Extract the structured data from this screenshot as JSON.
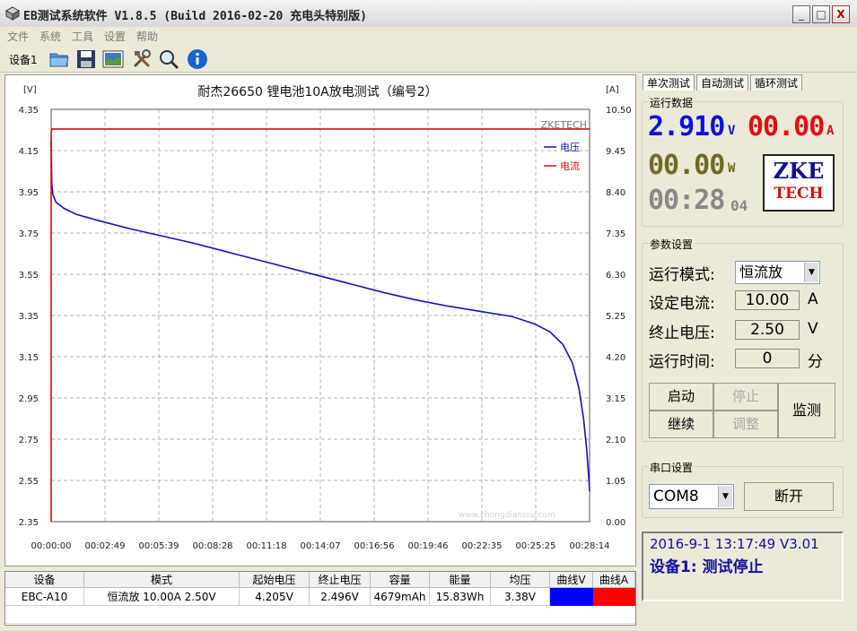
{
  "window": {
    "title": "EB测试系统软件 V1.8.5 (Build 2016-02-20 充电头特别版)",
    "buttons": [
      "_",
      "□",
      "X"
    ]
  },
  "menu": [
    "文件",
    "系统",
    "工具",
    "设置",
    "帮助"
  ],
  "toolbar": {
    "device_label": "设备1",
    "icons": [
      "open-folder-icon",
      "save-icon",
      "chart-image-icon",
      "tools-icon",
      "search-icon",
      "info-icon"
    ]
  },
  "chart_data": {
    "type": "line",
    "title": "耐杰26650 锂电池10A放电测试（编号2）",
    "left_axis_unit": "[V]",
    "right_axis_unit": "[A]",
    "watermark": "ZKETECH",
    "y_ticks": [
      "4.35",
      "4.15",
      "3.95",
      "3.75",
      "3.55",
      "3.35",
      "3.15",
      "2.95",
      "2.75",
      "2.55",
      "2.35"
    ],
    "y2_ticks": [
      "10.50",
      "9.45",
      "8.40",
      "7.35",
      "6.30",
      "5.25",
      "4.20",
      "3.15",
      "2.10",
      "1.05",
      "0.00"
    ],
    "x_ticks": [
      "00:00:00",
      "00:02:49",
      "00:05:39",
      "00:08:28",
      "00:11:18",
      "00:14:07",
      "00:16:56",
      "00:19:46",
      "00:22:35",
      "00:25:25",
      "00:28:14"
    ],
    "ylim": [
      2.35,
      4.35
    ],
    "y2lim": [
      0,
      10.5
    ],
    "xlim_seconds": [
      0,
      1694
    ],
    "grid": true,
    "legend_placement": "top-right",
    "series": [
      {
        "name": "电压",
        "color": "#1414b4",
        "axis": "left",
        "points": [
          [
            0,
            4.205
          ],
          [
            2,
            3.99
          ],
          [
            5,
            3.94
          ],
          [
            15,
            3.9
          ],
          [
            40,
            3.87
          ],
          [
            80,
            3.84
          ],
          [
            150,
            3.81
          ],
          [
            250,
            3.77
          ],
          [
            350,
            3.735
          ],
          [
            450,
            3.7
          ],
          [
            550,
            3.66
          ],
          [
            650,
            3.62
          ],
          [
            750,
            3.58
          ],
          [
            850,
            3.54
          ],
          [
            950,
            3.5
          ],
          [
            1050,
            3.46
          ],
          [
            1150,
            3.425
          ],
          [
            1250,
            3.395
          ],
          [
            1350,
            3.37
          ],
          [
            1450,
            3.345
          ],
          [
            1520,
            3.31
          ],
          [
            1570,
            3.27
          ],
          [
            1610,
            3.21
          ],
          [
            1640,
            3.12
          ],
          [
            1660,
            3.0
          ],
          [
            1675,
            2.85
          ],
          [
            1685,
            2.7
          ],
          [
            1692,
            2.55
          ],
          [
            1694,
            2.496
          ]
        ]
      },
      {
        "name": "电流",
        "color": "#d41010",
        "axis": "right",
        "points": [
          [
            0,
            0
          ],
          [
            0,
            9.9
          ],
          [
            2,
            10.0
          ],
          [
            1694,
            10.0
          ]
        ]
      }
    ]
  },
  "table": {
    "headers": [
      "设备",
      "模式",
      "起始电压",
      "终止电压",
      "容量",
      "能量",
      "均压",
      "曲线V",
      "曲线A"
    ],
    "rows": [
      {
        "device": "EBC-A10",
        "mode": "恒流放 10.00A 2.50V",
        "start_v": "4.205V",
        "end_v": "2.496V",
        "capacity": "4679mAh",
        "energy": "15.83Wh",
        "avg_v": "3.38V",
        "curve_v_color": "#0000ff",
        "curve_a_color": "#ff0000"
      }
    ]
  },
  "right": {
    "tabs": [
      "单次测试",
      "自动测试",
      "循环测试"
    ],
    "run_data_title": "运行数据",
    "voltage": "2.910",
    "voltage_unit": "V",
    "current": "00.00",
    "current_unit": "A",
    "power": "00.00",
    "power_unit": "W",
    "time": "00:28",
    "time_sec": "04",
    "logo_line1": "ZKE",
    "logo_line2": "TECH",
    "params_title": "参数设置",
    "mode_label": "运行模式:",
    "mode_value": "恒流放",
    "current_label": "设定电流:",
    "current_value": "10.00",
    "current_unit_label": "A",
    "cutoff_label": "终止电压:",
    "cutoff_value": "2.50",
    "cutoff_unit_label": "V",
    "time_label": "运行时间:",
    "time_value": "0",
    "time_unit_label": "分",
    "btn_start": "启动",
    "btn_stop": "停止",
    "btn_continue": "继续",
    "btn_adjust": "调整",
    "btn_monitor": "监测",
    "serial_title": "串口设置",
    "port": "COM8",
    "btn_disconnect": "断开",
    "status_line1": "2016-9-1 13:17:49  V3.01",
    "status_line2": "设备1: 测试停止"
  },
  "watermark_text": {
    "site": "www.chongdiantou.com"
  }
}
